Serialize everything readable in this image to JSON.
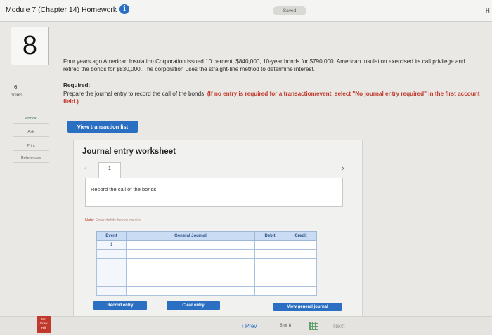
{
  "header": {
    "title": "Module 7 (Chapter 14) Homework",
    "saved_label": "Saved",
    "right_cut": "H"
  },
  "question": {
    "number": "8",
    "points_value": "6",
    "points_label": "points",
    "prompt": "Four years ago American Insulation Corporation issued 10 percent, $840,000, 10-year bonds for $790,000. American Insulation exercised its call privilege and retired the bonds for $830,000. The corporation uses the straight-line method to determine interest.",
    "required_label": "Required:",
    "required_text": "Prepare the journal entry to record the call of the bonds.",
    "required_note": "(If no entry is required for a transaction/event, select \"No journal entry required\" in the first account field.)"
  },
  "sidebar": {
    "ebook": "eBook",
    "ask": "Ask",
    "print": "Print",
    "references": "References"
  },
  "view_transaction_list": "View transaction list",
  "worksheet": {
    "title": "Journal entry worksheet",
    "tab": "1",
    "instruction": "Record the call of the bonds.",
    "note_label": "Note:",
    "note_text": "Enter debits before credits.",
    "columns": [
      "Event",
      "General Journal",
      "Debit",
      "Credit"
    ],
    "rows": [
      {
        "event": "1",
        "account": "",
        "debit": "",
        "credit": ""
      },
      {
        "event": "",
        "account": "",
        "debit": "",
        "credit": ""
      },
      {
        "event": "",
        "account": "",
        "debit": "",
        "credit": ""
      },
      {
        "event": "",
        "account": "",
        "debit": "",
        "credit": ""
      },
      {
        "event": "",
        "account": "",
        "debit": "",
        "credit": ""
      },
      {
        "event": "",
        "account": "",
        "debit": "",
        "credit": ""
      }
    ],
    "record_entry": "Record entry",
    "clear_entry": "Clear entry",
    "view_general_journal": "View general journal"
  },
  "footer": {
    "prev": "Prev",
    "page_indicator": "8 of 8",
    "next": "Next",
    "logo_text": "Mc Graw Hill"
  },
  "colors": {
    "accent": "#2a6fc2",
    "table_header": "#c9dcf4",
    "warning": "#c0392b"
  }
}
